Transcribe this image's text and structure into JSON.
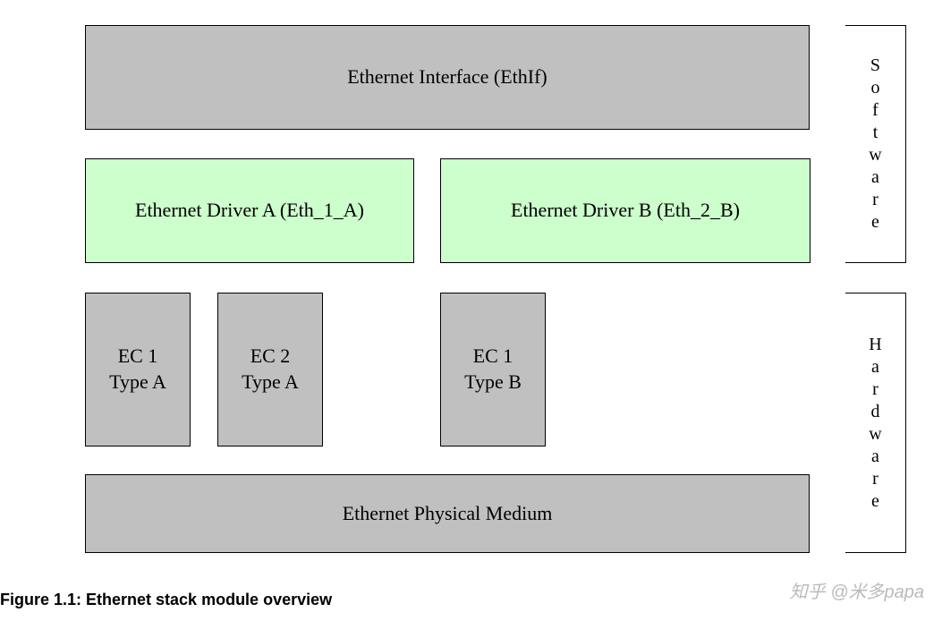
{
  "diagram": {
    "ethif": "Ethernet Interface (EthIf)",
    "driverA": "Ethernet Driver A (Eth_1_A)",
    "driverB": "Ethernet Driver B (Eth_2_B)",
    "ec1a_line1": "EC 1",
    "ec1a_line2": "Type A",
    "ec2a_line1": "EC 2",
    "ec2a_line2": "Type A",
    "ec1b_line1": "EC 1",
    "ec1b_line2": "Type B",
    "medium": "Ethernet Physical Medium",
    "software_label": "Software",
    "hardware_label": "Hardware"
  },
  "caption": "Figure 1.1: Ethernet stack module overview",
  "watermark": "知乎 @米多papa"
}
